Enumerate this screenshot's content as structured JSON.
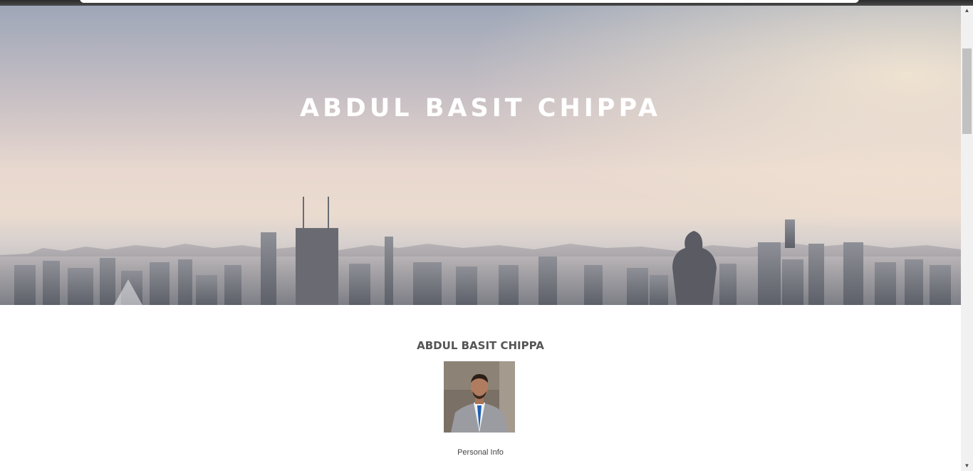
{
  "hero": {
    "title": "ABDUL BASIT CHIPPA"
  },
  "profile": {
    "name": "ABDUL BASIT CHIPPA",
    "section_link": "Personal Info"
  },
  "scrollbar": {
    "up_arrow": "▲",
    "down_arrow": "▼"
  }
}
